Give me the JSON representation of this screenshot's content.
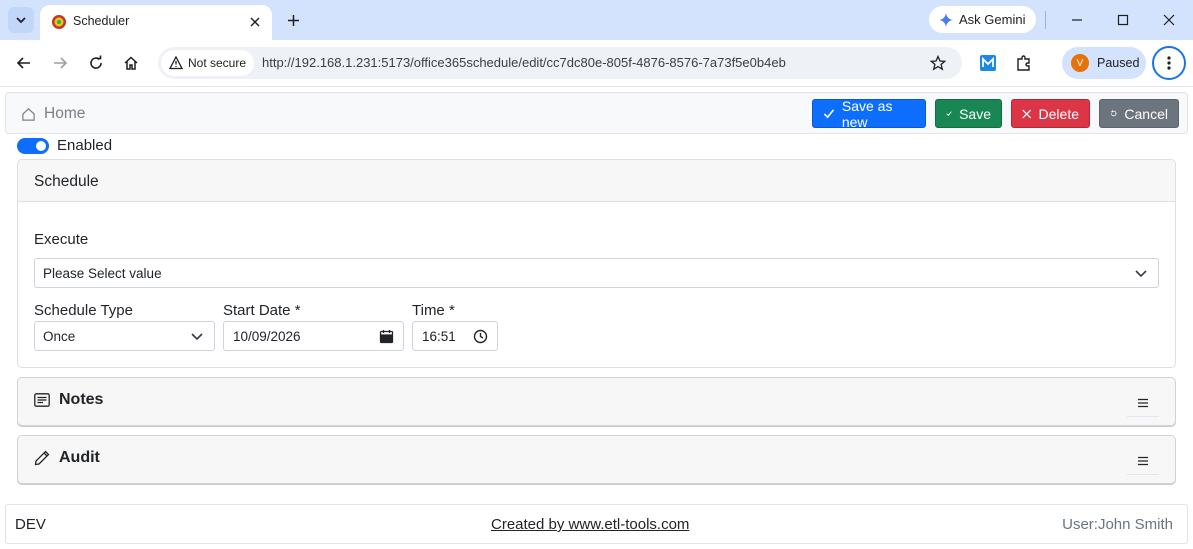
{
  "browser": {
    "tab_title": "Scheduler",
    "gemini_label": "Ask Gemini",
    "security_label": "Not secure",
    "url": "http://192.168.1.231:5173/office365schedule/edit/cc7dc80e-805f-4876-8576-7a73f5e0b4eb",
    "profile_initial": "V",
    "profile_status": "Paused"
  },
  "header": {
    "home_label": "Home",
    "save_as_new_label": "Save as new",
    "save_label": "Save",
    "delete_label": "Delete",
    "cancel_label": "Cancel"
  },
  "enabled": {
    "label": "Enabled",
    "checked": true
  },
  "schedule": {
    "title": "Schedule",
    "execute_label": "Execute",
    "execute_value": "Please Select value",
    "schedule_type_label": "Schedule Type",
    "schedule_type_value": "Once",
    "start_date_label": "Start Date *",
    "start_date_value": "10/09/2026",
    "time_label": "Time *",
    "time_value": "16:51"
  },
  "sections": {
    "notes_title": "Notes",
    "audit_title": "Audit"
  },
  "footer": {
    "env": "DEV",
    "credit": "Created by www.etl-tools.com",
    "user": "User:John Smith"
  },
  "colors": {
    "primary": "#0d6efd",
    "success": "#198754",
    "danger": "#dc3545",
    "secondary": "#6c757d",
    "chrome_accent": "#d3e3fd"
  }
}
